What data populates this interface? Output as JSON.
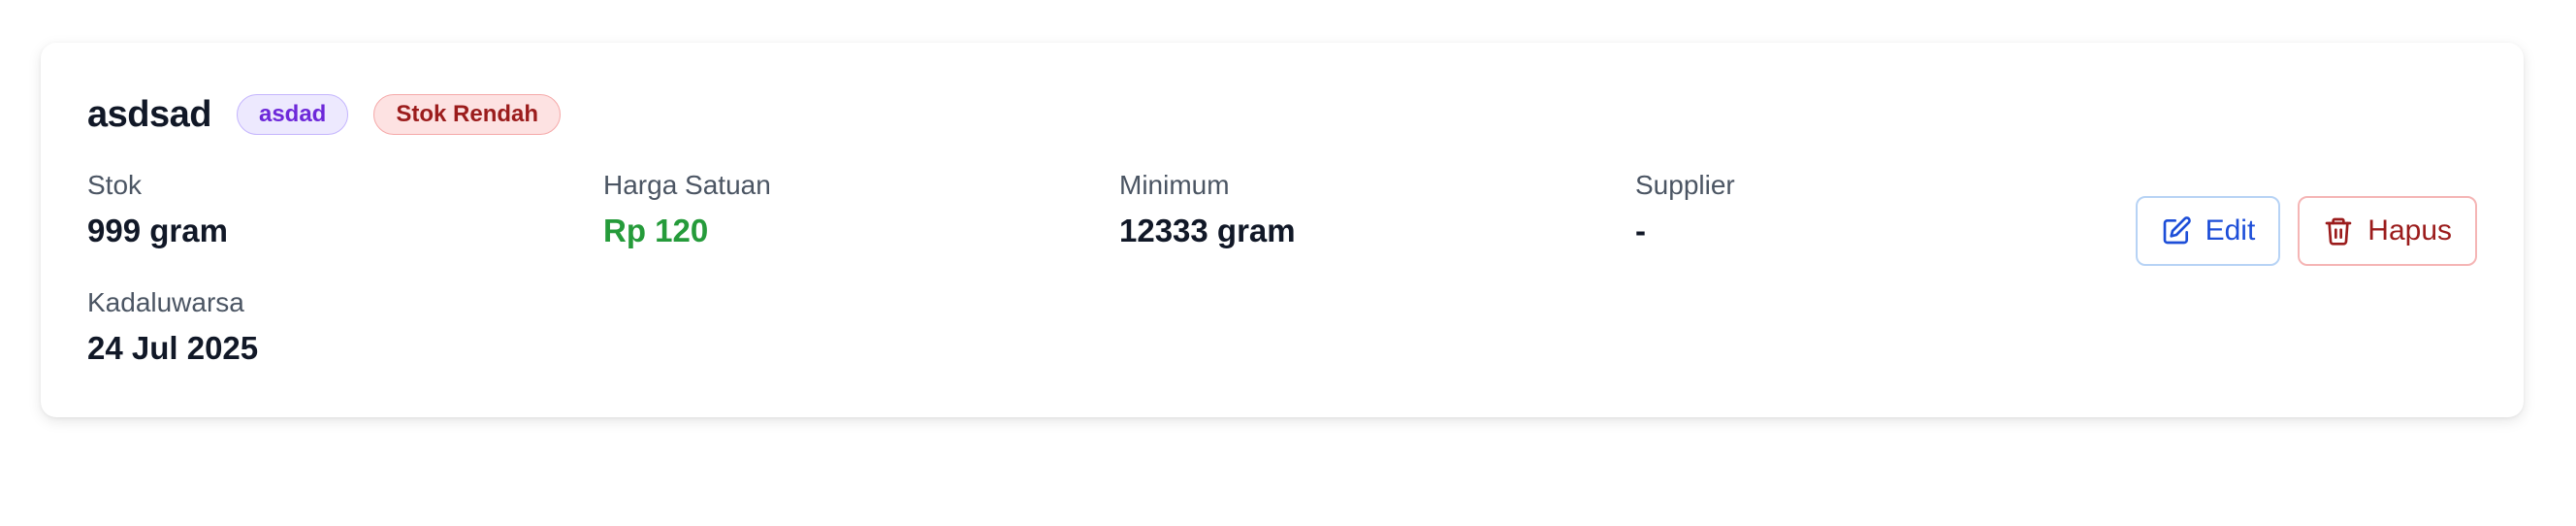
{
  "item": {
    "name": "asdsad",
    "category_badge": "asdad",
    "status_badge": "Stok Rendah"
  },
  "fields": {
    "stock": {
      "label": "Stok",
      "value": "999 gram"
    },
    "unit_price": {
      "label": "Harga Satuan",
      "value": "Rp 120"
    },
    "minimum": {
      "label": "Minimum",
      "value": "12333 gram"
    },
    "supplier": {
      "label": "Supplier",
      "value": "-"
    },
    "expiry": {
      "label": "Kadaluwarsa",
      "value": "24 Jul 2025"
    }
  },
  "actions": {
    "edit_label": "Edit",
    "delete_label": "Hapus",
    "edit_icon": "pencil-square-icon",
    "delete_icon": "trash-icon"
  },
  "colors": {
    "price": "#259b3a",
    "edit": "#1d4ed8",
    "delete": "#9b1c1c",
    "category_badge_bg": "#ede9fe",
    "status_badge_bg": "#fde2e2"
  }
}
